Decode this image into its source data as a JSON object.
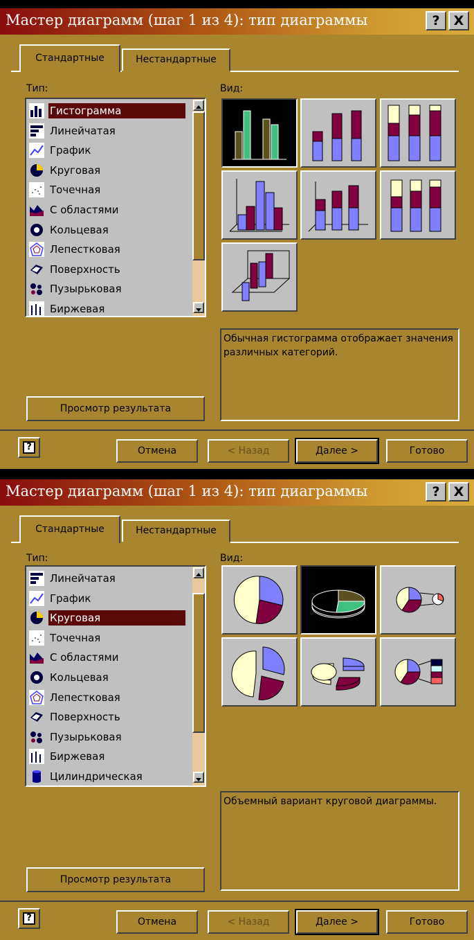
{
  "dialogs": [
    {
      "title": "Мастер диаграмм (шаг 1 из 4): тип диаграммы",
      "help_btn": "?",
      "close_btn": "X",
      "tabs": [
        "Стандартные",
        "Нестандартные"
      ],
      "type_label": "Тип:",
      "view_label": "Вид:",
      "list_items": [
        "Гистограмма",
        "Линейчатая",
        "График",
        "Круговая",
        "Точечная",
        "С областями",
        "Кольцевая",
        "Лепестковая",
        "Поверхность",
        "Пузырьковая",
        "Биржевая"
      ],
      "selected_item": "Гистограмма",
      "selected_view": 1,
      "description": "Обычная гистограмма отображает значения различных категорий.",
      "preview_btn": "Просмотр результата",
      "buttons": {
        "cancel": "Отмена",
        "back": "< Назад",
        "next": "Далее >",
        "finish": "Готово"
      }
    },
    {
      "title": "Мастер диаграмм (шаг 1 из 4): тип диаграммы",
      "help_btn": "?",
      "close_btn": "X",
      "tabs": [
        "Стандартные",
        "Нестандартные"
      ],
      "type_label": "Тип:",
      "view_label": "Вид:",
      "list_items": [
        "Линейчатая",
        "График",
        "Круговая",
        "Точечная",
        "С областями",
        "Кольцевая",
        "Лепестковая",
        "Поверхность",
        "Пузырьковая",
        "Биржевая",
        "Цилиндрическая"
      ],
      "selected_item": "Круговая",
      "selected_view": 2,
      "description": "Объемный вариант круговой диаграммы.",
      "preview_btn": "Просмотр результата",
      "buttons": {
        "cancel": "Отмена",
        "back": "< Назад",
        "next": "Далее >",
        "finish": "Готово"
      }
    }
  ],
  "icons": {
    "Гистограмма": "bar-chart-icon",
    "Линейчатая": "horizontal-bar-icon",
    "График": "line-chart-icon",
    "Круговая": "pie-chart-icon",
    "Точечная": "scatter-icon",
    "С областями": "area-chart-icon",
    "Кольцевая": "doughnut-icon",
    "Лепестковая": "radar-icon",
    "Поверхность": "surface-icon",
    "Пузырьковая": "bubble-icon",
    "Биржевая": "stock-icon",
    "Цилиндрическая": "cylinder-icon"
  },
  "colors": {
    "dialog_bg": "#a9852f",
    "selection": "#5a0a0a",
    "purple_bar": "#8080ff",
    "maroon_bar": "#800040",
    "cream": "#ffffcc",
    "teal": "#40c080"
  }
}
